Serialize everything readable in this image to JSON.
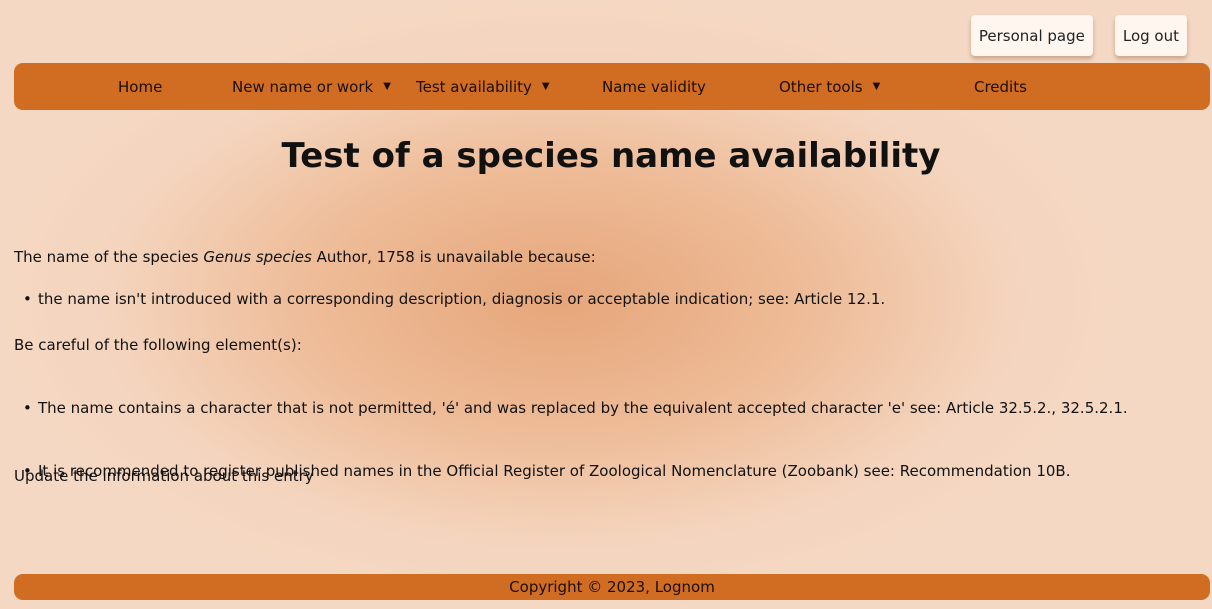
{
  "header": {
    "personal_page": "Personal page",
    "log_out": "Log out"
  },
  "nav": {
    "home": "Home",
    "new_name": "New name or work",
    "test_availability": "Test availability",
    "name_validity": "Name validity",
    "other_tools": "Other tools",
    "credits": "Credits",
    "caret": "▼"
  },
  "main": {
    "title": "Test of a species name availability",
    "intro_prefix": "The name of the species ",
    "intro_name": "Genus species",
    "intro_suffix": " Author, 1758 is unavailable because:",
    "reasons": [
      "the name isn't introduced with a corresponding description, diagnosis or acceptable indication; see: Article 12.1."
    ],
    "warnings_heading": "Be careful of the following element(s):",
    "warnings": [
      "The name contains a character that is not permitted, 'é' and was replaced by the equivalent accepted character 'e' see: Article 32.5.2., 32.5.2.1.",
      "It is recommended to register published names in the Official Register of Zoological Nomenclature (Zoobank) see: Recommendation 10B."
    ],
    "update_link": "Update the information about this entry"
  },
  "footer": {
    "copyright": "Copyright © 2023, Lognom"
  }
}
